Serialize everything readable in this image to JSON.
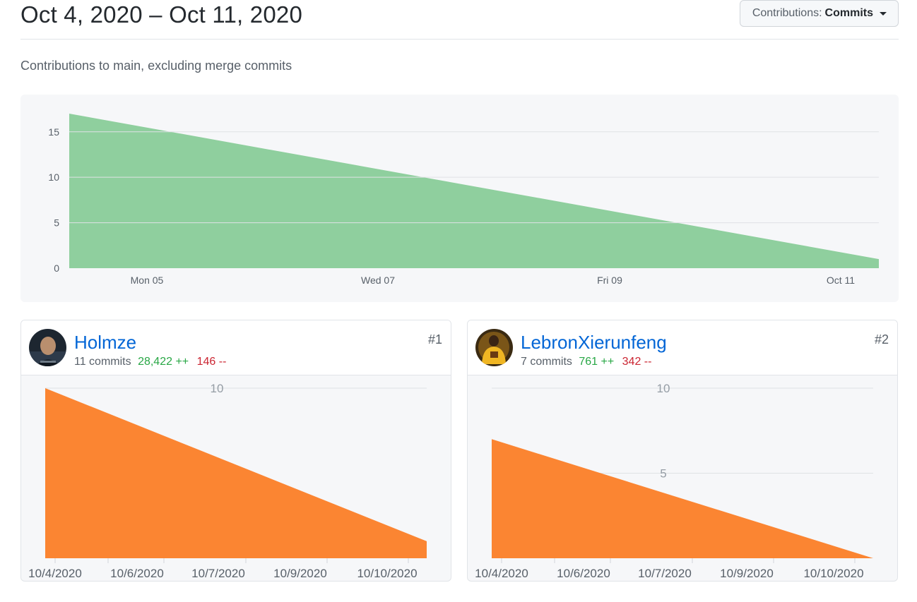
{
  "header": {
    "date_range": "Oct 4, 2020 – Oct 11, 2020",
    "contributions_label": "Contributions:",
    "contributions_value": "Commits"
  },
  "subtitle": "Contributions to main, excluding merge commits",
  "colors": {
    "main_fill": "#8fcf9e",
    "contributor_fill": "#fb8532",
    "link": "#0366d6",
    "additions": "#28a745",
    "deletions": "#cb2431"
  },
  "chart_data": [
    {
      "type": "area",
      "x": [
        "Oct 4",
        "Oct 11"
      ],
      "values": [
        17,
        1
      ],
      "x_tick_labels": [
        "Mon 05",
        "Wed 07",
        "Fri 09",
        "Oct 11"
      ],
      "y_ticks": [
        0,
        5,
        10,
        15
      ],
      "ylim": [
        0,
        17
      ],
      "grid": true
    },
    {
      "type": "area",
      "x": [
        "10/4/2020",
        "10/11/2020"
      ],
      "values": [
        10,
        1
      ],
      "x_tick_labels": [
        "10/4/2020",
        "10/6/2020",
        "10/7/2020",
        "10/9/2020",
        "10/10/2020"
      ],
      "y_ticks": [
        10
      ],
      "ylim": [
        0,
        10
      ],
      "grid": true
    },
    {
      "type": "area",
      "x": [
        "10/4/2020",
        "10/11/2020"
      ],
      "values": [
        7,
        0
      ],
      "x_tick_labels": [
        "10/4/2020",
        "10/6/2020",
        "10/7/2020",
        "10/9/2020",
        "10/10/2020"
      ],
      "y_ticks": [
        5,
        10
      ],
      "ylim": [
        0,
        10
      ],
      "grid": true
    }
  ],
  "contributors": [
    {
      "name": "Holmze",
      "rank": "#1",
      "commits": "11 commits",
      "additions": "28,422 ++",
      "deletions": "146 --"
    },
    {
      "name": "LebronXierunfeng",
      "rank": "#2",
      "commits": "7 commits",
      "additions": "761 ++",
      "deletions": "342 --"
    }
  ]
}
